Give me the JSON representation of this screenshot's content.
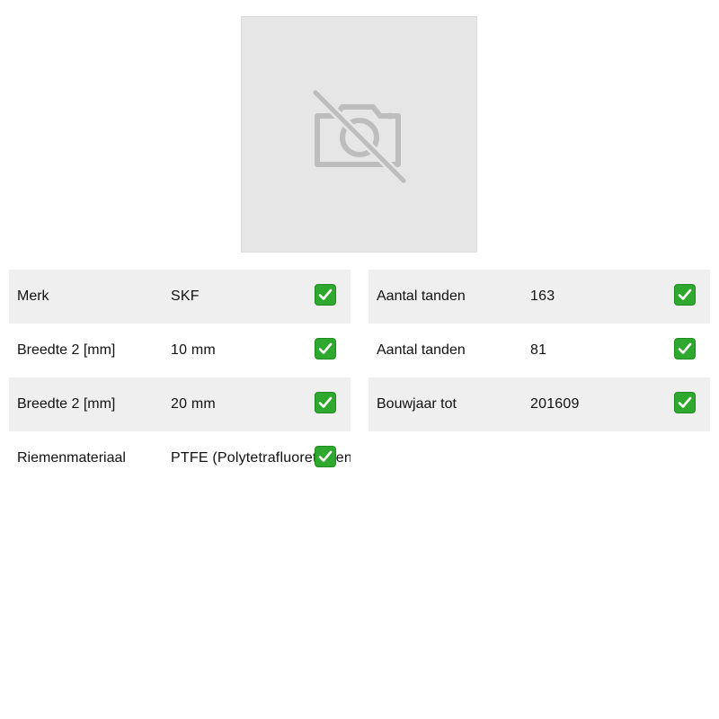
{
  "image": {
    "icon": "no-photo-icon"
  },
  "specs_left": [
    {
      "label": "Merk",
      "value": "SKF"
    },
    {
      "label": "Breedte 2 [mm]",
      "value": "10 mm"
    },
    {
      "label": "Breedte 2 [mm]",
      "value": "20 mm"
    },
    {
      "label": "Riemenmateriaal",
      "value": "PTFE (Polytetrafluorethylen)"
    }
  ],
  "specs_right": [
    {
      "label": "Aantal tanden",
      "value": "163"
    },
    {
      "label": "Aantal tanden",
      "value": "81"
    },
    {
      "label": "Bouwjaar tot",
      "value": "201609"
    }
  ],
  "colors": {
    "shaded_row": "#efefef",
    "placeholder_bg": "#e6e6e6",
    "check_green": "#2fa82f"
  }
}
